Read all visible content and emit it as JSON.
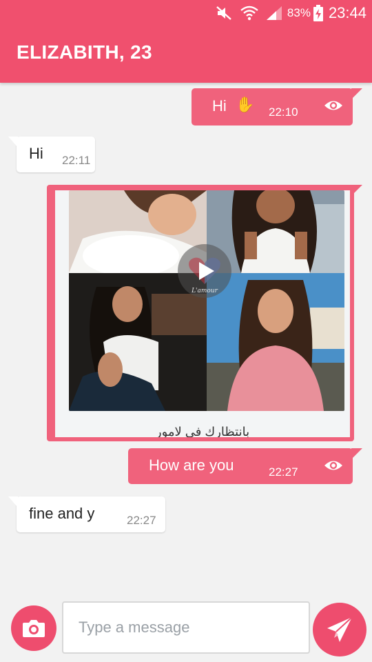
{
  "status_bar": {
    "battery_percent": "83%",
    "time": "23:44",
    "icons": [
      "mute-icon",
      "wifi-icon",
      "signal-icon",
      "battery-charging-icon"
    ]
  },
  "header": {
    "title": "ELIZABITH, 23"
  },
  "messages": [
    {
      "direction": "outgoing",
      "text": "Hi",
      "emoji": "✋",
      "time": "22:10",
      "seen": true
    },
    {
      "direction": "incoming",
      "text": "Hi",
      "time": "22:11"
    },
    {
      "direction": "outgoing",
      "type": "image-card",
      "caption": "بانتظارك في لامور",
      "overlay_logo": "L'amour"
    },
    {
      "direction": "outgoing",
      "text": "How are you",
      "time": "22:27",
      "seen": true
    },
    {
      "direction": "incoming",
      "text": "fine and y",
      "time": "22:27"
    }
  ],
  "composer": {
    "placeholder": "Type a message",
    "camera_icon": "camera-icon",
    "send_icon": "send-icon"
  },
  "colors": {
    "accent": "#f0506e",
    "outgoing_bubble": "#f0627c",
    "incoming_bubble": "#ffffff",
    "background": "#f2f2f2"
  }
}
